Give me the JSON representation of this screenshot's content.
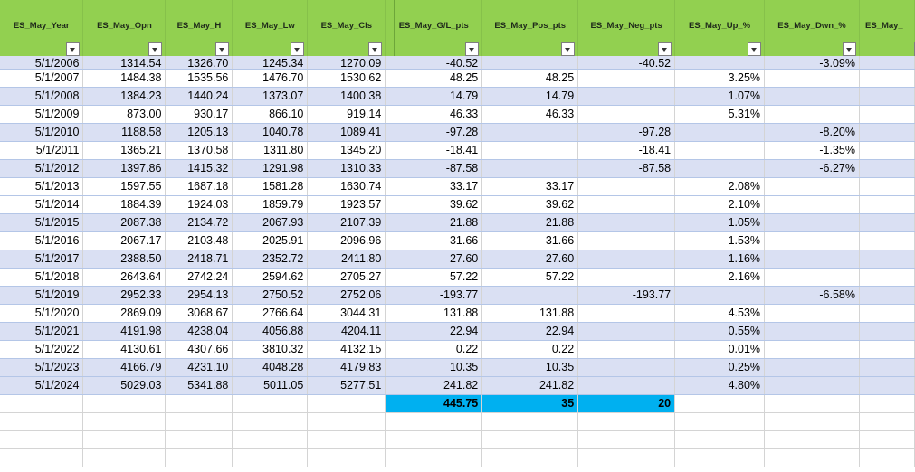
{
  "headers": [
    "ES_May_Year",
    "ES_May_Opn",
    "ES_May_H",
    "ES_May_Lw",
    "ES_May_Cls",
    "ES_May_G/L_pts",
    "ES_May_Pos_pts",
    "ES_May_Neg_pts",
    "ES_May_Up_%",
    "ES_May_Dwn_%",
    "ES_May_"
  ],
  "rows": [
    [
      "5/1/2006",
      "1314.54",
      "1326.70",
      "1245.34",
      "1270.09",
      "-40.52",
      "",
      "-40.52",
      "",
      "-3.09%",
      ""
    ],
    [
      "5/1/2007",
      "1484.38",
      "1535.56",
      "1476.70",
      "1530.62",
      "48.25",
      "48.25",
      "",
      "3.25%",
      "",
      ""
    ],
    [
      "5/1/2008",
      "1384.23",
      "1440.24",
      "1373.07",
      "1400.38",
      "14.79",
      "14.79",
      "",
      "1.07%",
      "",
      ""
    ],
    [
      "5/1/2009",
      "873.00",
      "930.17",
      "866.10",
      "919.14",
      "46.33",
      "46.33",
      "",
      "5.31%",
      "",
      ""
    ],
    [
      "5/1/2010",
      "1188.58",
      "1205.13",
      "1040.78",
      "1089.41",
      "-97.28",
      "",
      "-97.28",
      "",
      "-8.20%",
      ""
    ],
    [
      "5/1/2011",
      "1365.21",
      "1370.58",
      "1311.80",
      "1345.20",
      "-18.41",
      "",
      "-18.41",
      "",
      "-1.35%",
      ""
    ],
    [
      "5/1/2012",
      "1397.86",
      "1415.32",
      "1291.98",
      "1310.33",
      "-87.58",
      "",
      "-87.58",
      "",
      "-6.27%",
      ""
    ],
    [
      "5/1/2013",
      "1597.55",
      "1687.18",
      "1581.28",
      "1630.74",
      "33.17",
      "33.17",
      "",
      "2.08%",
      "",
      ""
    ],
    [
      "5/1/2014",
      "1884.39",
      "1924.03",
      "1859.79",
      "1923.57",
      "39.62",
      "39.62",
      "",
      "2.10%",
      "",
      ""
    ],
    [
      "5/1/2015",
      "2087.38",
      "2134.72",
      "2067.93",
      "2107.39",
      "21.88",
      "21.88",
      "",
      "1.05%",
      "",
      ""
    ],
    [
      "5/1/2016",
      "2067.17",
      "2103.48",
      "2025.91",
      "2096.96",
      "31.66",
      "31.66",
      "",
      "1.53%",
      "",
      ""
    ],
    [
      "5/1/2017",
      "2388.50",
      "2418.71",
      "2352.72",
      "2411.80",
      "27.60",
      "27.60",
      "",
      "1.16%",
      "",
      ""
    ],
    [
      "5/1/2018",
      "2643.64",
      "2742.24",
      "2594.62",
      "2705.27",
      "57.22",
      "57.22",
      "",
      "2.16%",
      "",
      ""
    ],
    [
      "5/1/2019",
      "2952.33",
      "2954.13",
      "2750.52",
      "2752.06",
      "-193.77",
      "",
      "-193.77",
      "",
      "-6.58%",
      ""
    ],
    [
      "5/1/2020",
      "2869.09",
      "3068.67",
      "2766.64",
      "3044.31",
      "131.88",
      "131.88",
      "",
      "4.53%",
      "",
      ""
    ],
    [
      "5/1/2021",
      "4191.98",
      "4238.04",
      "4056.88",
      "4204.11",
      "22.94",
      "22.94",
      "",
      "0.55%",
      "",
      ""
    ],
    [
      "5/1/2022",
      "4130.61",
      "4307.66",
      "3810.32",
      "4132.15",
      "0.22",
      "0.22",
      "",
      "0.01%",
      "",
      ""
    ],
    [
      "5/1/2023",
      "4166.79",
      "4231.10",
      "4048.28",
      "4179.83",
      "10.35",
      "10.35",
      "",
      "0.25%",
      "",
      ""
    ],
    [
      "5/1/2024",
      "5029.03",
      "5341.88",
      "5011.05",
      "5277.51",
      "241.82",
      "241.82",
      "",
      "4.80%",
      "",
      ""
    ]
  ],
  "totals": [
    "",
    "",
    "",
    "",
    "",
    "445.75",
    "35",
    "20",
    "",
    "",
    ""
  ],
  "colors": {
    "header_bg": "#92d050",
    "band": "#dae0f3",
    "total_highlight": "#00b0f0"
  }
}
